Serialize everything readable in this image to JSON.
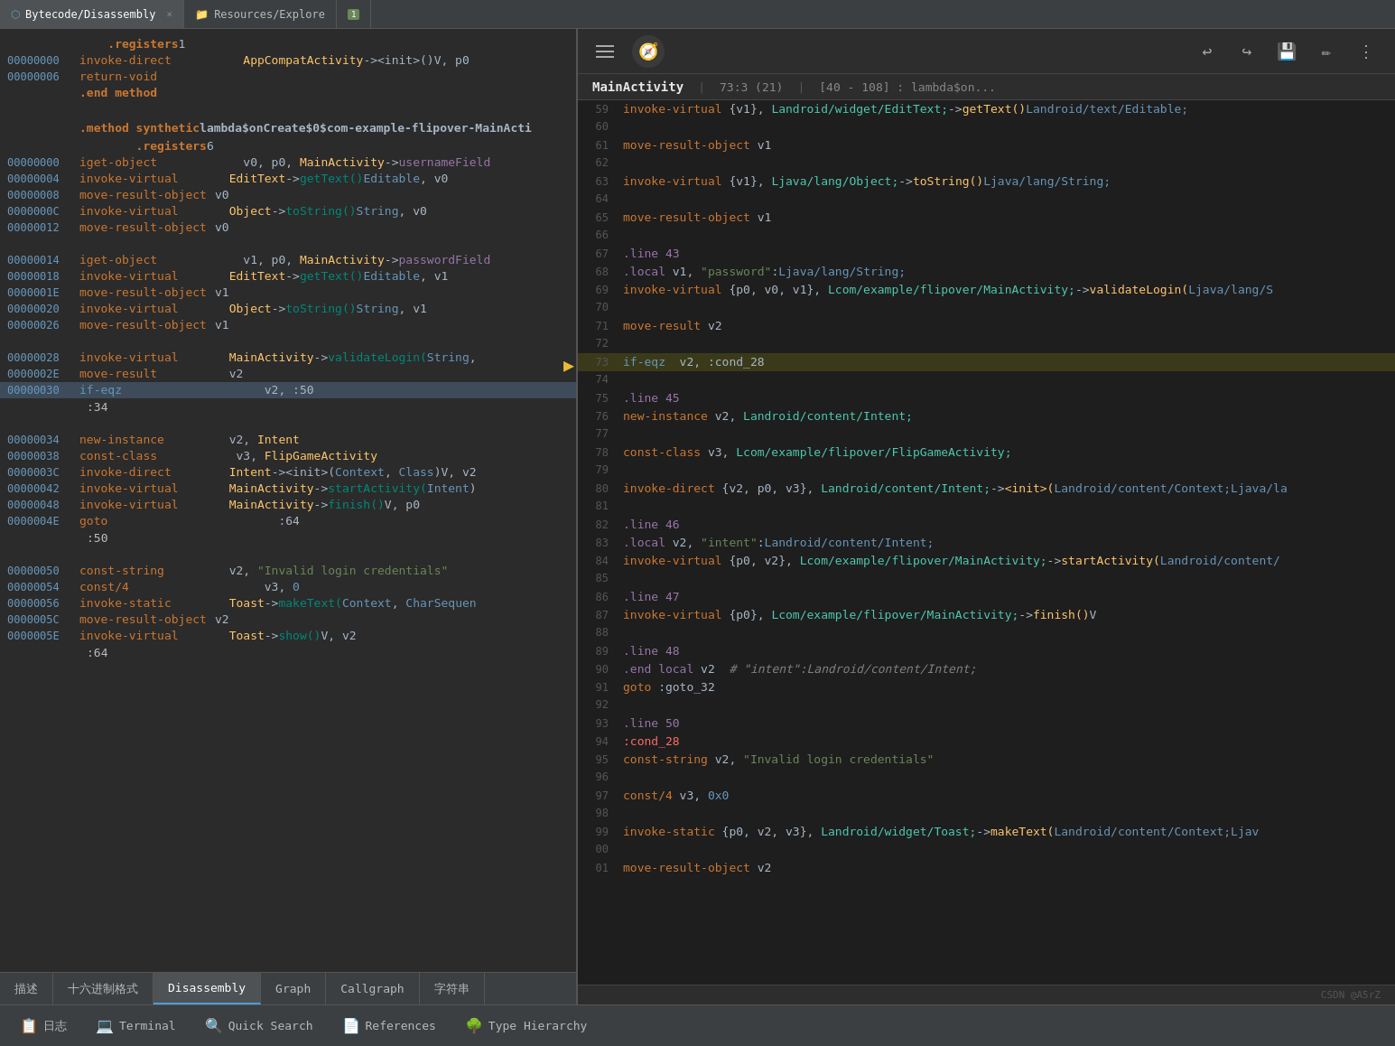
{
  "tabs": [
    {
      "label": "Bytecode/Disassembly",
      "icon": "file",
      "active": true,
      "closeable": true
    },
    {
      "label": "Resources/Explore",
      "icon": "folder",
      "active": false,
      "closeable": false
    },
    {
      "label": "1",
      "icon": "",
      "active": false,
      "closeable": false,
      "is_num": true
    }
  ],
  "left_panel": {
    "code_lines": [
      {
        "addr": "",
        "opcode": ".registers",
        "operands": " 1",
        "type": "directive"
      },
      {
        "addr": "00000000",
        "opcode": "invoke-direct",
        "operands": "    AppCompatActivity-><init>()V, p0",
        "hl": false
      },
      {
        "addr": "00000006",
        "opcode": "return-void",
        "operands": "",
        "hl": false
      },
      {
        "addr": "",
        "opcode": ".end method",
        "operands": "",
        "type": "directive"
      },
      {
        "addr": "",
        "opcode": "",
        "operands": "",
        "type": "empty"
      },
      {
        "addr": "",
        "opcode": ".method synthetic",
        "operands": " lambda$onCreate$0$com-example-flipover-MainActi",
        "type": "method_header"
      },
      {
        "addr": "",
        "opcode": "    .registers",
        "operands": " 6",
        "type": "directive"
      },
      {
        "addr": "00000000",
        "opcode": "iget-object",
        "operands": "    v0, p0, MainActivity->usernameField",
        "hl": false
      },
      {
        "addr": "00000004",
        "opcode": "invoke-virtual",
        "operands": "  EditText->getText()Editable, v0",
        "hl": false
      },
      {
        "addr": "00000008",
        "opcode": "move-result-object",
        "operands": " v0",
        "hl": false
      },
      {
        "addr": "0000000C",
        "opcode": "invoke-virtual",
        "operands": "  Object->toString()String, v0",
        "hl": false
      },
      {
        "addr": "00000012",
        "opcode": "move-result-object",
        "operands": " v0",
        "hl": false
      },
      {
        "addr": "",
        "opcode": "",
        "operands": "",
        "type": "empty"
      },
      {
        "addr": "00000014",
        "opcode": "iget-object",
        "operands": "    v1, p0, MainActivity->passwordField",
        "hl": false
      },
      {
        "addr": "00000018",
        "opcode": "invoke-virtual",
        "operands": "  EditText->getText()Editable, v1",
        "hl": false
      },
      {
        "addr": "0000001E",
        "opcode": "move-result-object",
        "operands": " v1",
        "hl": false
      },
      {
        "addr": "00000020",
        "opcode": "invoke-virtual",
        "operands": "  Object->toString()String, v1",
        "hl": false
      },
      {
        "addr": "00000026",
        "opcode": "move-result-object",
        "operands": " v1",
        "hl": false
      },
      {
        "addr": "",
        "opcode": "",
        "operands": "",
        "type": "empty"
      },
      {
        "addr": "00000028",
        "opcode": "invoke-virtual",
        "operands": "  MainActivity->validateLogin(String,",
        "hl": false
      },
      {
        "addr": "0000002E",
        "opcode": "move-result",
        "operands": "  v2",
        "hl": false
      },
      {
        "addr": "00000030",
        "opcode": "if-eqz",
        "operands": "       v2, :50",
        "hl": true
      },
      {
        "addr": "",
        "opcode": ":34",
        "operands": "",
        "type": "label"
      },
      {
        "addr": "",
        "opcode": "",
        "operands": "",
        "type": "empty"
      },
      {
        "addr": "00000034",
        "opcode": "new-instance",
        "operands": "  v2, Intent",
        "hl": false
      },
      {
        "addr": "00000038",
        "opcode": "const-class",
        "operands": "   v3, FlipGameActivity",
        "hl": false
      },
      {
        "addr": "0000003C",
        "opcode": "invoke-direct",
        "operands": "  Intent-><init>(Context, Class)V, v2",
        "hl": false
      },
      {
        "addr": "00000042",
        "opcode": "invoke-virtual",
        "operands": "  MainActivity->startActivity(Intent)",
        "hl": false
      },
      {
        "addr": "00000048",
        "opcode": "invoke-virtual",
        "operands": "  MainActivity->finish()V, p0",
        "hl": false
      },
      {
        "addr": "0000004E",
        "opcode": "goto",
        "operands": "         :64",
        "hl": false
      },
      {
        "addr": "",
        "opcode": ":50",
        "operands": "",
        "type": "label"
      },
      {
        "addr": "",
        "opcode": "",
        "operands": "",
        "type": "empty"
      },
      {
        "addr": "00000050",
        "opcode": "const-string",
        "operands": "  v2, \"Invalid login credentials\"",
        "hl": false
      },
      {
        "addr": "00000054",
        "opcode": "const/4",
        "operands": "       v3, 0",
        "hl": false
      },
      {
        "addr": "00000056",
        "opcode": "invoke-static",
        "operands": "  Toast->makeText(Context, CharSequen",
        "hl": false
      },
      {
        "addr": "0000005C",
        "opcode": "move-result-object",
        "operands": " v2",
        "hl": false
      },
      {
        "addr": "0000005E",
        "opcode": "invoke-virtual",
        "operands": "  Toast->show()V, v2",
        "hl": false
      },
      {
        "addr": "",
        "opcode": ":64",
        "operands": "",
        "type": "label"
      }
    ],
    "bottom_tabs": [
      {
        "label": "描述",
        "active": false
      },
      {
        "label": "十六进制格式",
        "active": false
      },
      {
        "label": "Disassembly",
        "active": true
      },
      {
        "label": "Graph",
        "active": false
      },
      {
        "label": "Callgraph",
        "active": false
      },
      {
        "label": "字符串",
        "active": false
      }
    ]
  },
  "footer_toolbar": {
    "items": [
      {
        "label": "日志",
        "icon": "📋"
      },
      {
        "label": "Terminal",
        "icon": "💻"
      },
      {
        "label": "Quick Search",
        "icon": "🔍"
      },
      {
        "label": "References",
        "icon": "📄"
      },
      {
        "label": "Type Hierarchy",
        "icon": "🌳"
      }
    ]
  },
  "right_panel": {
    "header": {
      "filename": "MainActivity",
      "position": "73:3 (21)",
      "range": "[40 - 108] : lambda$on..."
    },
    "code_lines": [
      {
        "num": "59",
        "content": "invoke-virtual {v1}, Landroid/widget/EditText;->getText()Landroid/text/Editable;"
      },
      {
        "num": "60",
        "content": ""
      },
      {
        "num": "61",
        "content": "move-result-object v1"
      },
      {
        "num": "62",
        "content": ""
      },
      {
        "num": "63",
        "content": "invoke-virtual {v1}, Ljava/lang/Object;->toString()Ljava/lang/String;"
      },
      {
        "num": "64",
        "content": ""
      },
      {
        "num": "65",
        "content": "move-result-object v1"
      },
      {
        "num": "66",
        "content": ""
      },
      {
        "num": "67",
        "content": ".line 43"
      },
      {
        "num": "68",
        "content": ".local v1, \"password\":Ljava/lang/String;"
      },
      {
        "num": "69",
        "content": "invoke-virtual {p0, v0, v1}, Lcom/example/flipover/MainActivity;->validateLogin(Ljava/lang/S"
      },
      {
        "num": "70",
        "content": ""
      },
      {
        "num": "71",
        "content": "move-result v2"
      },
      {
        "num": "72",
        "content": ""
      },
      {
        "num": "73",
        "content": "if-eqz  v2, :cond_28",
        "highlighted": true
      },
      {
        "num": "74",
        "content": ""
      },
      {
        "num": "75",
        "content": ".line 45"
      },
      {
        "num": "76",
        "content": "new-instance v2, Landroid/content/Intent;"
      },
      {
        "num": "77",
        "content": ""
      },
      {
        "num": "78",
        "content": "const-class v3, Lcom/example/flipover/FlipGameActivity;"
      },
      {
        "num": "79",
        "content": ""
      },
      {
        "num": "80",
        "content": "invoke-direct {v2, p0, v3}, Landroid/content/Intent;-><init>(Landroid/content/Context;Ljava/la"
      },
      {
        "num": "81",
        "content": ""
      },
      {
        "num": "82",
        "content": ".line 46"
      },
      {
        "num": "83",
        "content": ".local v2, \"intent\":Landroid/content/Intent;"
      },
      {
        "num": "84",
        "content": "invoke-virtual {p0, v2}, Lcom/example/flipover/MainActivity;->startActivity(Landroid/content/"
      },
      {
        "num": "85",
        "content": ""
      },
      {
        "num": "86",
        "content": ".line 47"
      },
      {
        "num": "87",
        "content": "invoke-virtual {p0}, Lcom/example/flipover/MainActivity;->finish()V"
      },
      {
        "num": "88",
        "content": ""
      },
      {
        "num": "89",
        "content": ".line 48"
      },
      {
        "num": "90",
        "content": ".end local v2   # \"intent\":Landroid/content/Intent;"
      },
      {
        "num": "91",
        "content": "goto :goto_32"
      },
      {
        "num": "92",
        "content": ""
      },
      {
        "num": "93",
        "content": ".line 50"
      },
      {
        "num": "94",
        "content": ":cond_28"
      },
      {
        "num": "95",
        "content": "const-string v2, \"Invalid login credentials\""
      },
      {
        "num": "96",
        "content": ""
      },
      {
        "num": "97",
        "content": "const/4 v3, 0x0"
      },
      {
        "num": "98",
        "content": ""
      },
      {
        "num": "99",
        "content": "invoke-static {p0, v2, v3}, Landroid/widget/Toast;->makeText(Landroid/content/Context;Ljav"
      },
      {
        "num": "00",
        "content": ""
      },
      {
        "num": "01",
        "content": "move-result-object v2"
      }
    ],
    "watermark": "CSDN @A5rZ"
  }
}
